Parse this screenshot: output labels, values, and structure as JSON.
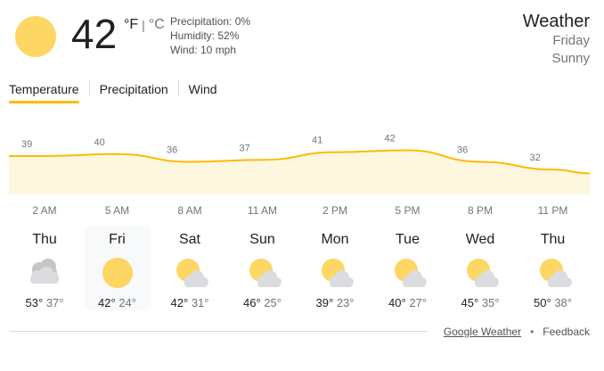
{
  "current": {
    "temperature": "42",
    "unit_f": "°F",
    "unit_sep": "|",
    "unit_c": "°C",
    "precipitation": "Precipitation: 0%",
    "humidity": "Humidity: 52%",
    "wind": "Wind: 10 mph",
    "icon": "sun-icon"
  },
  "header": {
    "title": "Weather",
    "day": "Friday",
    "condition": "Sunny"
  },
  "tabs": [
    {
      "label": "Temperature",
      "active": true
    },
    {
      "label": "Precipitation",
      "active": false
    },
    {
      "label": "Wind",
      "active": false
    }
  ],
  "chart_data": {
    "type": "area",
    "x": [
      "2 AM",
      "5 AM",
      "8 AM",
      "11 AM",
      "2 PM",
      "5 PM",
      "8 PM",
      "11 PM"
    ],
    "labeled_values": [
      39,
      40,
      36,
      37,
      41,
      42,
      36,
      32
    ],
    "colors": {
      "line": "#fbbc04",
      "fill": "#fef7e0",
      "label": "#70757a"
    }
  },
  "days": [
    {
      "name": "Thu",
      "hi": "53°",
      "lo": "37°",
      "icon": "cloudy-icon",
      "selected": false
    },
    {
      "name": "Fri",
      "hi": "42°",
      "lo": "24°",
      "icon": "sun-icon",
      "selected": true
    },
    {
      "name": "Sat",
      "hi": "42°",
      "lo": "31°",
      "icon": "partly-cloudy-icon",
      "selected": false
    },
    {
      "name": "Sun",
      "hi": "46°",
      "lo": "25°",
      "icon": "partly-cloudy-icon",
      "selected": false
    },
    {
      "name": "Mon",
      "hi": "39°",
      "lo": "23°",
      "icon": "partly-cloudy-icon",
      "selected": false
    },
    {
      "name": "Tue",
      "hi": "40°",
      "lo": "27°",
      "icon": "partly-cloudy-icon",
      "selected": false
    },
    {
      "name": "Wed",
      "hi": "45°",
      "lo": "35°",
      "icon": "partly-cloudy-icon",
      "selected": false
    },
    {
      "name": "Thu",
      "hi": "50°",
      "lo": "38°",
      "icon": "partly-cloudy-icon",
      "selected": false
    }
  ],
  "footer": {
    "source_link": "Google Weather",
    "separator": "•",
    "feedback": "Feedback"
  }
}
